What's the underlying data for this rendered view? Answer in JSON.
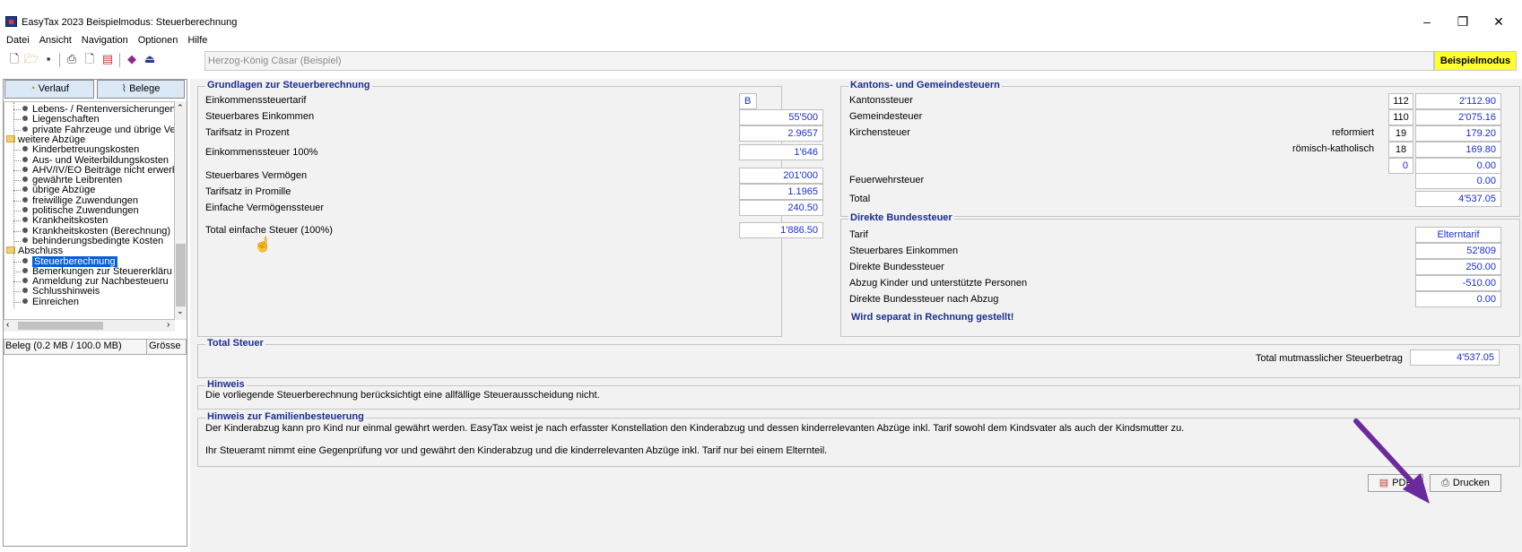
{
  "window": {
    "title": "EasyTax 2023 Beispielmodus: Steuerberechnung",
    "minimize": "–",
    "maximize": "❐",
    "close": "✕"
  },
  "menu": [
    "Datei",
    "Ansicht",
    "Navigation",
    "Optionen",
    "Hilfe"
  ],
  "toolbar": {
    "taxpayer": "Herzog-König Cäsar (Beispiel)",
    "mode": "Beispielmodus"
  },
  "left": {
    "tab_history": "Verlauf",
    "tab_receipts": "Belege",
    "tree": [
      {
        "label": "Lebens- / Rentenversicherungen",
        "type": "item"
      },
      {
        "label": "Liegenschaften",
        "type": "item"
      },
      {
        "label": "private Fahrzeuge und übrige Ve",
        "type": "item"
      },
      {
        "label": "weitere Abzüge",
        "type": "folder"
      },
      {
        "label": "Kinderbetreuungskosten",
        "type": "item"
      },
      {
        "label": "Aus- und Weiterbildungskosten",
        "type": "item"
      },
      {
        "label": "AHV/IV/EO Beiträge nicht erwerb",
        "type": "item"
      },
      {
        "label": "gewährte Leibrenten",
        "type": "item"
      },
      {
        "label": "übrige Abzüge",
        "type": "item"
      },
      {
        "label": "freiwillige Zuwendungen",
        "type": "item"
      },
      {
        "label": "politische Zuwendungen",
        "type": "item"
      },
      {
        "label": "Krankheitskosten",
        "type": "item"
      },
      {
        "label": "Krankheitskosten (Berechnung)",
        "type": "item"
      },
      {
        "label": "behinderungsbedingte Kosten",
        "type": "item"
      },
      {
        "label": "Abschluss",
        "type": "folder"
      },
      {
        "label": "Steuerberechnung",
        "type": "selected"
      },
      {
        "label": "Bemerkungen zur Steuererkläru",
        "type": "item"
      },
      {
        "label": "Anmeldung zur Nachbesteueru",
        "type": "item"
      },
      {
        "label": "Schlusshinweis",
        "type": "item"
      },
      {
        "label": "Einreichen",
        "type": "item"
      }
    ],
    "beleg_label": "Beleg (0.2 MB / 100.0 MB)",
    "beleg_size_col": "Grösse"
  },
  "grundlagen": {
    "title": "Grundlagen zur Steuerberechnung",
    "rows": [
      {
        "label": "Einkommenssteuertarif",
        "value": "B"
      },
      {
        "label": "Steuerbares Einkommen",
        "value": "55'500"
      },
      {
        "label": "Tarifsatz in Prozent",
        "value": "2.9657"
      },
      {
        "label": "Einkommenssteuer 100%",
        "value": "1'646"
      },
      {
        "label": "Steuerbares Vermögen",
        "value": "201'000"
      },
      {
        "label": "Tarifsatz in Promille",
        "value": "1.1965"
      },
      {
        "label": "Einfache Vermögenssteuer",
        "value": "240.50"
      },
      {
        "label": "Total einfache Steuer (100%)",
        "value": "1'886.50"
      }
    ]
  },
  "kanton": {
    "title": "Kantons- und Gemeindesteuern",
    "kantonssteuer": {
      "label": "Kantonssteuer",
      "rate": "112",
      "value": "2'112.90"
    },
    "gemeindesteuer": {
      "label": "Gemeindesteuer",
      "rate": "110",
      "value": "2'075.16"
    },
    "kirchensteuer_label": "Kirchensteuer",
    "reformiert": {
      "label": "reformiert",
      "rate": "19",
      "value": "179.20"
    },
    "katholisch": {
      "label": "römisch-katholisch",
      "rate": "18",
      "value": "169.80"
    },
    "other": {
      "rate": "0",
      "value": "0.00"
    },
    "feuerwehr": {
      "label": "Feuerwehrsteuer",
      "value": "0.00"
    },
    "total": {
      "label": "Total",
      "value": "4'537.05"
    }
  },
  "bund": {
    "title": "Direkte Bundessteuer",
    "tarif": {
      "label": "Tarif",
      "value": "Elterntarif"
    },
    "einkommen": {
      "label": "Steuerbares Einkommen",
      "value": "52'809"
    },
    "dbst": {
      "label": "Direkte Bundessteuer",
      "value": "250.00"
    },
    "abzug": {
      "label": "Abzug Kinder und unterstützte Personen",
      "value": "-510.00"
    },
    "nach_abzug": {
      "label": "Direkte Bundessteuer nach Abzug",
      "value": "0.00"
    },
    "note": "Wird separat in Rechnung gestellt!"
  },
  "total": {
    "title": "Total Steuer",
    "label": "Total mutmasslicher Steuerbetrag",
    "value": "4'537.05"
  },
  "hinweis": {
    "title": "Hinweis",
    "text": "Die vorliegende Steuerberechnung berücksichtigt eine allfällige Steuerausscheidung nicht."
  },
  "familie": {
    "title": "Hinweis zur Familienbesteuerung",
    "text1": "Der Kinderabzug kann pro Kind nur einmal gewährt werden. EasyTax weist je nach erfasster Konstellation den Kinderabzug und dessen kinderrelevanten Abzüge inkl. Tarif sowohl dem Kindsvater als auch der Kindsmutter zu.",
    "text2": "Ihr Steueramt nimmt eine Gegenprüfung vor und gewährt den Kinderabzug und die kinderrelevanten Abzüge inkl. Tarif nur bei einem Elternteil."
  },
  "buttons": {
    "pdf": "PDF",
    "print": "Drucken"
  },
  "colors": {
    "accent_blue": "#1b2d8f",
    "value_blue": "#1a2fd1",
    "mode_yellow": "#ffff2e",
    "arrow_purple": "#6a2a9e"
  }
}
